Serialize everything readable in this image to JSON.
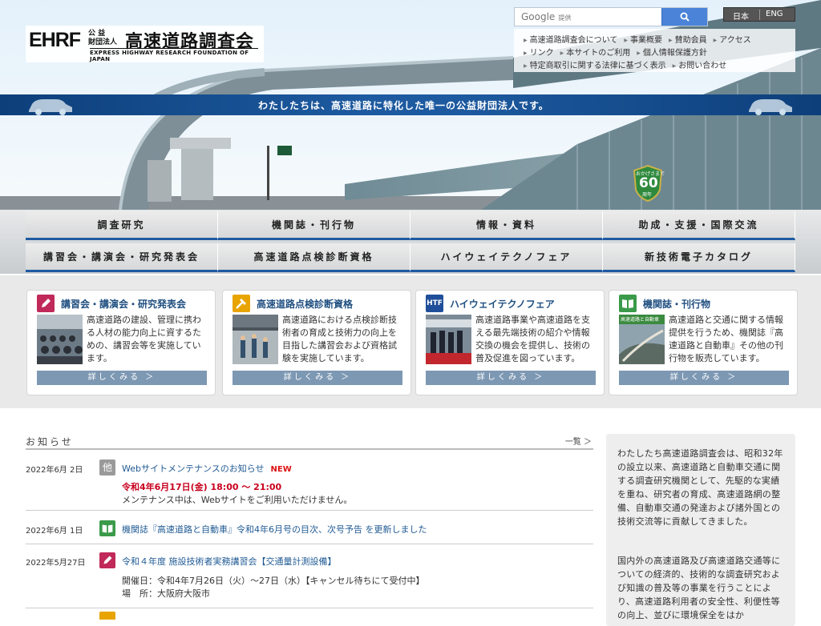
{
  "header": {
    "logo": {
      "abbr": "EHRF",
      "kana_line1": "公 益",
      "kana_line2": "財団法人",
      "name": "高速道路調査会",
      "english": "EXPRESS HIGHWAY RESEARCH FOUNDATION OF JAPAN"
    },
    "search": {
      "placeholder_main": "Google",
      "placeholder_sub": "提供",
      "button_icon": "search-icon"
    },
    "languages": [
      "日本",
      "ENG"
    ],
    "utility_links_row1": [
      "高速道路調査会について",
      "事業概要",
      "賛助会員",
      "アクセス"
    ],
    "utility_links_row2": [
      "リンク",
      "本サイトのご利用",
      "個人情報保護方針"
    ],
    "utility_links_row3": [
      "特定商取引に関する法律に基づく表示",
      "お問い合わせ"
    ],
    "tagline": "わたしたちは、高速道路に特化した唯一の公益財団法人です。",
    "badge": {
      "line1": "おかげさまで",
      "number": "60",
      "line2": "周年"
    }
  },
  "nav": {
    "row1": [
      "調査研究",
      "機関誌・刊行物",
      "情報・資料",
      "助成・支援・国際交流"
    ],
    "row2": [
      "講習会・講演会・研究発表会",
      "高速道路点検診断資格",
      "ハイウェイテクノフェア",
      "新技術電子カタログ"
    ]
  },
  "cards": [
    {
      "icon": "pencil-icon",
      "icon_text": "",
      "color": "#c0295a",
      "title": "講習会・講演会・研究発表会",
      "desc": "高速道路の建設、管理に携わる人材の能力向上に資するための、講習会等を実施しています。",
      "more": "詳しくみる ＞"
    },
    {
      "icon": "hammer-icon",
      "icon_text": "",
      "color": "#e8a400",
      "title": "高速道路点検診断資格",
      "desc": "高速道路における点検診断技術者の育成と技術力の向上を目指した講習会および資格試験を実施しています。",
      "more": "詳しくみる ＞"
    },
    {
      "icon": "htf-icon",
      "icon_text": "HTF",
      "color": "#1f4f9a",
      "title": "ハイウェイテクノフェア",
      "desc": "高速道路事業や高速道路を支える最先端技術の紹介や情報交換の機会を提供し、技術の普及促進を図っています。",
      "more": "詳しくみる ＞"
    },
    {
      "icon": "book-icon",
      "icon_text": "",
      "color": "#3a9a4a",
      "title": "機関誌・刊行物",
      "desc": "高速道路と交通に関する情報提供を行うため、機関誌『高速道路と自動車』その他の刊行物を販売しています。",
      "more": "詳しくみる ＞",
      "thumb_label": "高速道路と自動車"
    }
  ],
  "news": {
    "heading": "お知らせ",
    "all_link": "一覧 ＞",
    "items": [
      {
        "date": "2022年6月 2日",
        "icon_text": "他",
        "icon_color": "#9a9a9a",
        "title": "Webサイトメンテナンスのお知らせ",
        "new": "NEW",
        "emphasis": "令和4年6月17日(金) 18:00 ～ 21:00",
        "text": "メンテナンス中は、Webサイトをご利用いただけません。"
      },
      {
        "date": "2022年6月 1日",
        "icon_color": "#3a9a4a",
        "title": "機関誌『高速道路と自動車』令和4年6月号の目次、次号予告 を更新しました"
      },
      {
        "date": "2022年5月27日",
        "icon_color": "#c0295a",
        "title": "令和４年度 施設技術者実務講習会【交通量計測設備】",
        "text1": "開催日：令和4年7月26日（火）～27日（水）【キャンセル待ちにて受付中】",
        "text2": "場　所：大阪府大阪市"
      }
    ]
  },
  "about": {
    "p1": "わたしたち高速道路調査会は、昭和32年の設立以来、高速道路と自動車交通に関する調査研究機関として、先駆的な実績を重ね、研究者の育成、高速道路網の整備、自動車交通の発達および諸外国との技術交流等に貢献してきました。",
    "p2": "国内外の高速道路及び高速道路交通等についての経済的、技術的な調査研究および知識の普及等の事業を行うことにより、高速道路利用者の安全性、利便性等の向上、並びに環境保全をはか"
  }
}
